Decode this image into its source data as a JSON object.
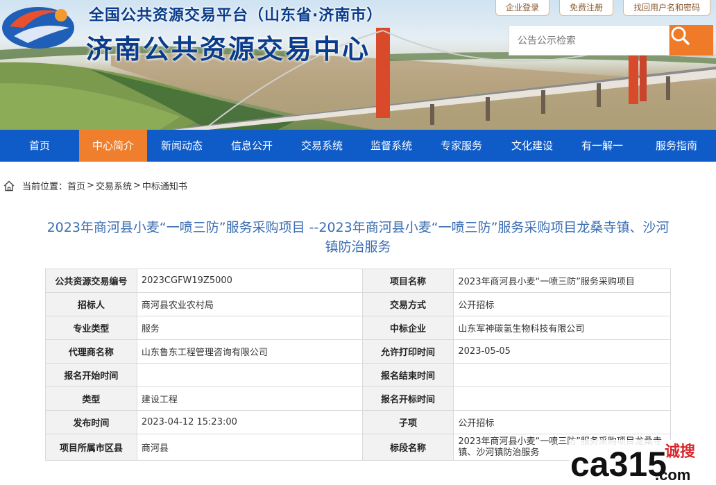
{
  "header": {
    "platform_title": "全国公共资源交易平台（山东省·济南市）",
    "center_title": "济南公共资源交易中心",
    "top_links": [
      "企业登录",
      "免费注册",
      "找回用户名和密码"
    ],
    "search_placeholder": "公告公示检索"
  },
  "nav": {
    "items": [
      "首页",
      "中心简介",
      "新闻动态",
      "信息公开",
      "交易系统",
      "监督系统",
      "专家服务",
      "文化建设",
      "有一解一",
      "服务指南"
    ],
    "active_index": 1
  },
  "breadcrumb": {
    "prefix": "当前位置：",
    "items": [
      "首页",
      "交易系统",
      "中标通知书"
    ]
  },
  "document": {
    "title": "2023年商河县小麦“一喷三防”服务采购项目 --2023年商河县小麦“一喷三防”服务采购项目龙桑寺镇、沙河镇防治服务"
  },
  "info_table": [
    {
      "label_left": "公共资源交易编号",
      "value_left": "2023CGFW19Z5000",
      "label_right": "项目名称",
      "value_right": "2023年商河县小麦“一喷三防”服务采购项目"
    },
    {
      "label_left": "招标人",
      "value_left": "商河县农业农村局",
      "label_right": "交易方式",
      "value_right": "公开招标"
    },
    {
      "label_left": "专业类型",
      "value_left": "服务",
      "label_right": "中标企业",
      "value_right": "山东军神碳氢生物科技有限公司"
    },
    {
      "label_left": "代理商名称",
      "value_left": "山东鲁东工程管理咨询有限公司",
      "label_right": "允许打印时间",
      "value_right": "2023-05-05"
    },
    {
      "label_left": "报名开始时间",
      "value_left": "",
      "label_right": "报名结束时间",
      "value_right": ""
    },
    {
      "label_left": "类型",
      "value_left": "建设工程",
      "label_right": "报名开标时间",
      "value_right": ""
    },
    {
      "label_left": "发布时间",
      "value_left": "2023-04-12 15:23:00",
      "label_right": "子项",
      "value_right": "公开招标"
    },
    {
      "label_left": "项目所属市区县",
      "value_left": "商河县",
      "label_right": "标段名称",
      "value_right": "2023年商河县小麦“一喷三防”服务采购项目龙桑寺镇、沙河镇防治服务"
    }
  ],
  "watermark": {
    "brand": "ca315",
    "domain": ".com",
    "slogan": "诚搜"
  },
  "colors": {
    "nav_bg": "#0f5cc8",
    "nav_active": "#f07f2d",
    "title_blue": "#3a6db3",
    "search_orange": "#ef7a28",
    "brand_blue": "#0b3c8c"
  },
  "icons": {
    "logo": "jinan-ggzy-logo",
    "search": "search-icon",
    "home": "home-icon"
  }
}
